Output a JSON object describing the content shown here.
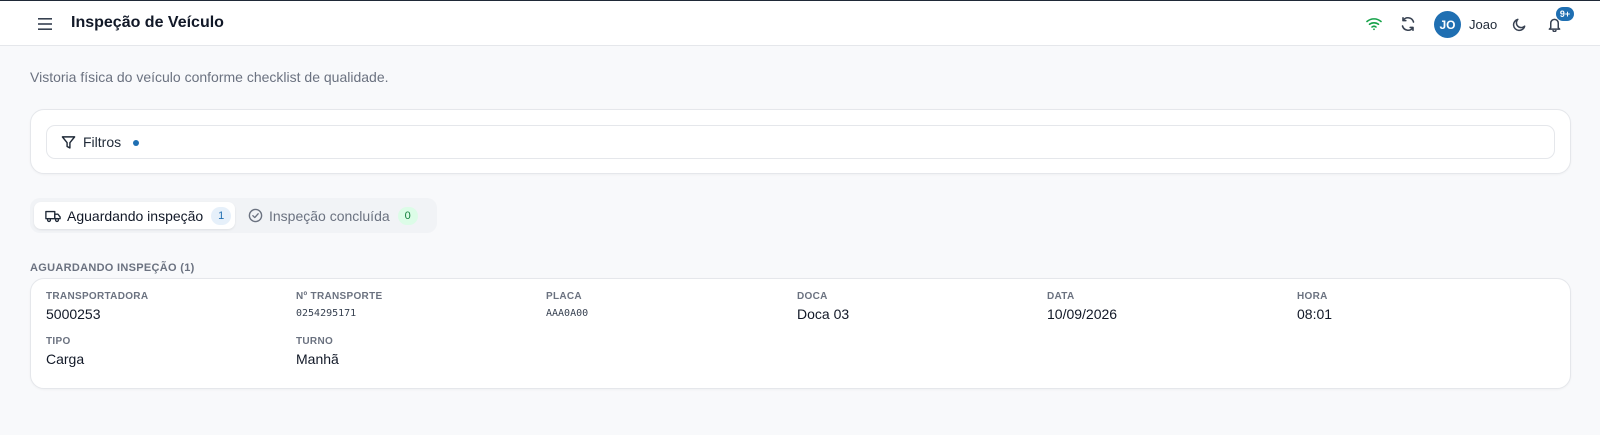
{
  "header": {
    "title": "Inspeção de Veículo",
    "user_initials": "JO",
    "user_name": "Joao",
    "notification_count": "9+",
    "wifi_color": "#16a34a",
    "accent_color": "#1f6fb2"
  },
  "page": {
    "subtitle": "Vistoria física do veículo conforme checklist de qualidade."
  },
  "filters": {
    "label": "Filtros"
  },
  "tabs": [
    {
      "label": "Aguardando inspeção",
      "count": "1",
      "icon": "truck-icon",
      "active": true
    },
    {
      "label": "Inspeção concluída",
      "count": "0",
      "icon": "check-circle-icon",
      "active": false
    }
  ],
  "list": {
    "section_title": "AGUARDANDO INSPEÇÃO (1)",
    "records": [
      {
        "fields": [
          {
            "label": "TRANSPORTADORA",
            "value": "5000253"
          },
          {
            "label": "Nº TRANSPORTE",
            "value": "0254295171"
          },
          {
            "label": "PLACA",
            "value": "AAA0A00"
          },
          {
            "label": "DOCA",
            "value": "Doca 03"
          },
          {
            "label": "DATA",
            "value": "10/09/2026"
          },
          {
            "label": "HORA",
            "value": "08:01"
          },
          {
            "label": "TIPO",
            "value": "Carga"
          },
          {
            "label": "TURNO",
            "value": "Manhã"
          }
        ]
      }
    ]
  }
}
